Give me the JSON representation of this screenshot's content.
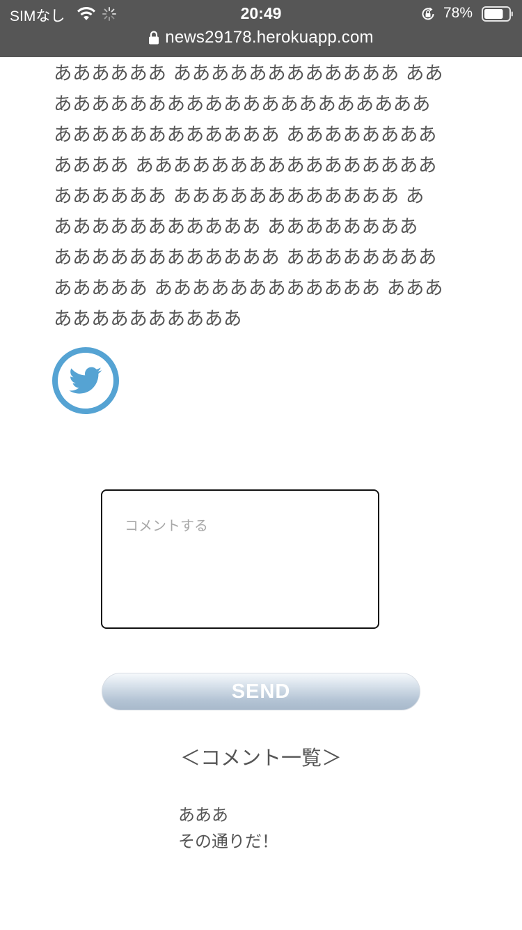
{
  "status_bar": {
    "carrier": "SIMなし",
    "time": "20:49",
    "battery_percent": "78%",
    "battery_level": 0.78,
    "url": "news29178.herokuapp.com"
  },
  "article": {
    "lines": [
      "ああああああ ああああああああああああ ああ",
      "ああああああああああああああああああああ",
      "ああああああああああああ ああああああああ",
      "ああああ ああああああああああああああああ",
      "ああああああ ああああああああああああ あ",
      "あああああああああああ ああああああああ",
      "ああああああああああああ ああああああああ",
      "あああああ ああああああああああああ あああ",
      "ああああああああああ"
    ]
  },
  "share": {
    "icon": "twitter-icon",
    "color": "#55a3d3"
  },
  "comment_form": {
    "placeholder": "コメントする",
    "value": "",
    "send_label": "SEND"
  },
  "comment_list": {
    "title": "＜コメント一覧＞",
    "items": [
      {
        "text": "あああ"
      },
      {
        "text": "その通りだ！"
      }
    ]
  }
}
